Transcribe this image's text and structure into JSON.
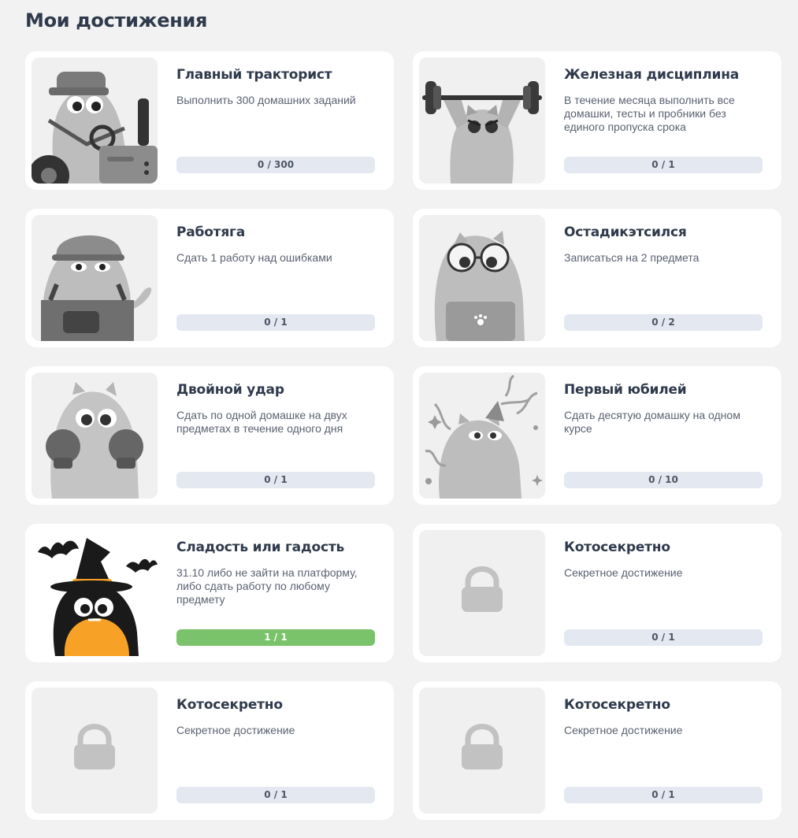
{
  "page": {
    "title": "Мои достижения"
  },
  "achievements": [
    {
      "icon": "cat-tractor-driver-illustration",
      "title": "Главный тракторист",
      "description": "Выполнить 300 домашних заданий",
      "progress_text": "0 / 300",
      "current": 0,
      "total": 300
    },
    {
      "icon": "cat-barbell-illustration",
      "title": "Железная дисциплина",
      "description": "В течение месяца выполнить все домашки, тесты и пробники без единого пропуска срока",
      "progress_text": "0 / 1",
      "current": 0,
      "total": 1
    },
    {
      "icon": "cat-worker-helmet-illustration",
      "title": "Работяга",
      "description": "Сдать 1 работу над ошибками",
      "progress_text": "0 / 1",
      "current": 0,
      "total": 1
    },
    {
      "icon": "cat-glasses-laptop-illustration",
      "title": "Остадикэтсился",
      "description": "Записаться на 2 предмета",
      "progress_text": "0 / 2",
      "current": 0,
      "total": 2
    },
    {
      "icon": "cat-boxing-gloves-illustration",
      "title": "Двойной удар",
      "description": "Сдать по одной домашке на двух предметах в течение одного дня",
      "progress_text": "0 / 1",
      "current": 0,
      "total": 1
    },
    {
      "icon": "cat-party-confetti-illustration",
      "title": "Первый юбилей",
      "description": "Сдать десятую домашку на одном курсе",
      "progress_text": "0 / 10",
      "current": 0,
      "total": 10
    },
    {
      "icon": "cat-witch-hat-bats-illustration",
      "title": "Сладость или гадость",
      "description": "31.10 либо не зайти на платформу, либо сдать работу по любому предмету",
      "progress_text": "1 / 1",
      "current": 1,
      "total": 1
    },
    {
      "icon": "lock-icon",
      "title": "Котосекретно",
      "description": "Секретное достижение",
      "progress_text": "0 / 1",
      "current": 0,
      "total": 1
    },
    {
      "icon": "lock-icon",
      "title": "Котосекретно",
      "description": "Секретное достижение",
      "progress_text": "0 / 1",
      "current": 0,
      "total": 1
    },
    {
      "icon": "lock-icon",
      "title": "Котосекретно",
      "description": "Секретное достижение",
      "progress_text": "0 / 1",
      "current": 0,
      "total": 1
    }
  ],
  "colors": {
    "background": "#f2f2f2",
    "card": "#ffffff",
    "title": "#2f3a4c",
    "description": "#5a6170",
    "progress_track": "#e3e8f1",
    "progress_complete": "#7ac36a",
    "halloween_orange": "#f7a126"
  }
}
